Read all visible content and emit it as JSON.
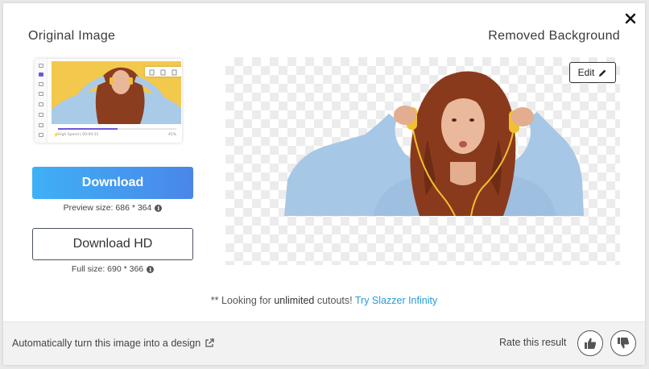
{
  "headings": {
    "original": "Original Image",
    "removed": "Removed Background"
  },
  "thumbnail": {
    "status_text": "High Speed | 00:00:31",
    "percent_text": "45%",
    "progress": 0.5,
    "accent_color": "#6a5ad8",
    "bg_color": "#f2c94c"
  },
  "download": {
    "label": "Download",
    "preview_size": "Preview size: 686 * 364",
    "hd_label": "Download HD",
    "full_size": "Full size: 690 * 366",
    "gradient_colors": [
      "#3fb0f6",
      "#4a86e8"
    ]
  },
  "result": {
    "edit_label": "Edit"
  },
  "promo": {
    "prefix": "** Looking for",
    "emphasis": "unlimited",
    "suffix": "cutouts!",
    "link": "Try Slazzer Infinity",
    "link_color": "#2a9ad6"
  },
  "footer": {
    "design_link": "Automatically turn this image into a design",
    "rate_label": "Rate this result"
  },
  "icons": {
    "close": "close-icon",
    "info": "info-icon",
    "edit": "pencil-icon",
    "external": "external-link-icon",
    "like": "thumbs-up-icon",
    "dislike": "thumbs-down-icon"
  }
}
